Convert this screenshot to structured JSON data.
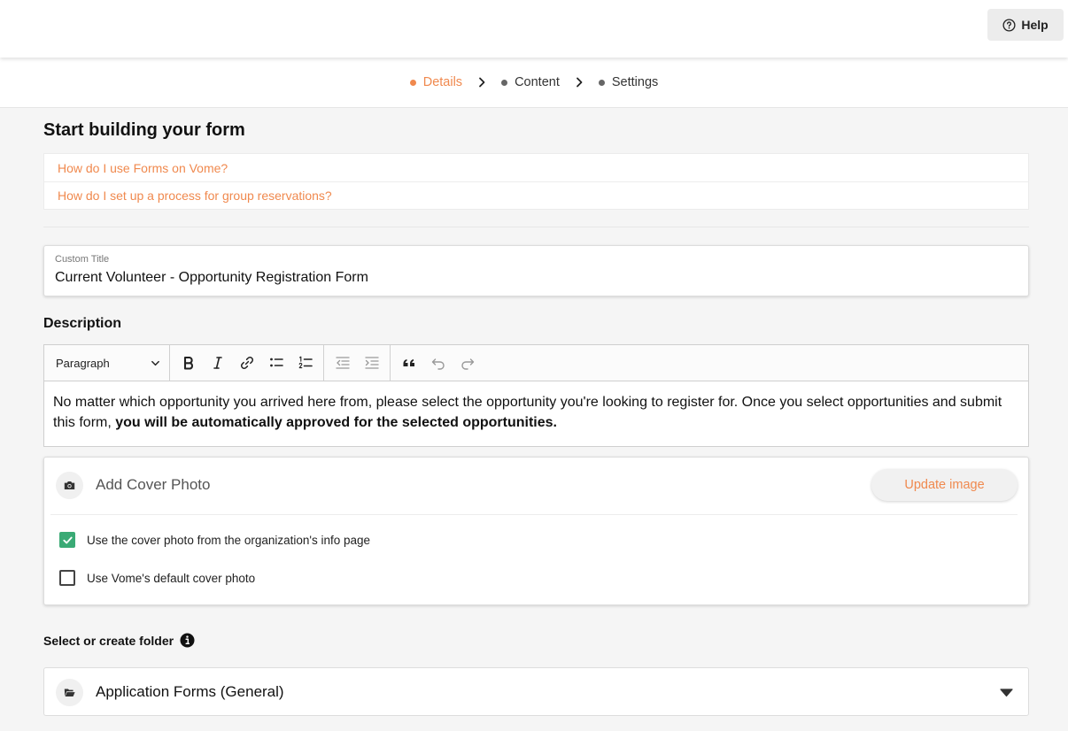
{
  "header": {
    "help_label": "Help"
  },
  "steps": [
    {
      "label": "Details",
      "active": true
    },
    {
      "label": "Content",
      "active": false
    },
    {
      "label": "Settings",
      "active": false
    }
  ],
  "page": {
    "title": "Start building your form"
  },
  "help_links": [
    "How do I use Forms on Vome?",
    "How do I set up a process for group reservations?"
  ],
  "custom_title": {
    "label": "Custom Title",
    "value": "Current Volunteer - Opportunity Registration Form"
  },
  "description": {
    "label": "Description",
    "block_format": "Paragraph",
    "toolbar_icons": [
      "bold-icon",
      "italic-icon",
      "link-icon",
      "bullet-list-icon",
      "numbered-list-icon",
      "outdent-icon",
      "indent-icon",
      "blockquote-icon",
      "undo-icon",
      "redo-icon"
    ],
    "text_regular": "No matter which opportunity you arrived here from, please select the opportunity you're looking to register for. Once you select opportunities and submit this form, ",
    "text_bold": "you will be automatically approved for the selected opportunities."
  },
  "cover_photo": {
    "label": "Add Cover Photo",
    "update_button": "Update image",
    "options": [
      {
        "label": "Use the cover photo from the organization's info page",
        "checked": true
      },
      {
        "label": "Use Vome's default cover photo",
        "checked": false
      }
    ]
  },
  "folder": {
    "label": "Select or create folder",
    "selected": "Application Forms (General)"
  },
  "colors": {
    "accent": "#f0894e",
    "check_green": "#3aaa75",
    "background": "#f5f5f5"
  }
}
